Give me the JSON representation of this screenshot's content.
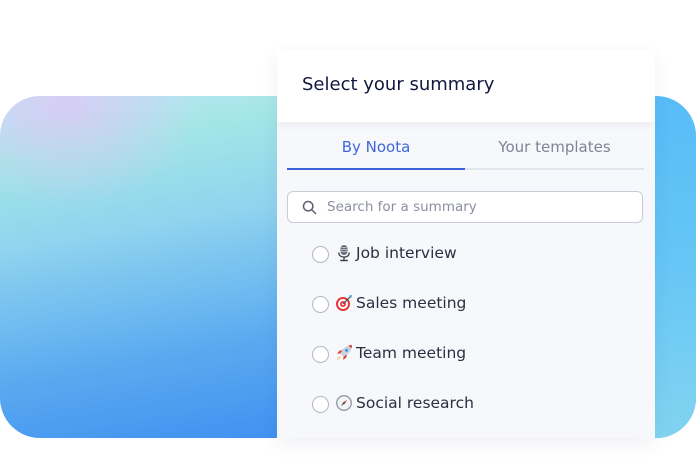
{
  "panel": {
    "title": "Select your summary"
  },
  "tabs": [
    {
      "label": "By Noota",
      "active": true
    },
    {
      "label": "Your templates",
      "active": false
    }
  ],
  "search": {
    "placeholder": "Search for a summary",
    "value": "",
    "icon": "search-icon"
  },
  "options": [
    {
      "label": "Job interview",
      "icon": "microphone-icon",
      "selected": false
    },
    {
      "label": "Sales meeting",
      "icon": "target-icon",
      "selected": false
    },
    {
      "label": "Team meeting",
      "icon": "rocket-icon",
      "selected": false
    },
    {
      "label": "Social research",
      "icon": "compass-icon",
      "selected": false
    }
  ],
  "colors": {
    "accent": "#3c64d8",
    "title": "#11183f",
    "inactive_tab": "#7f8496",
    "panel_background": "#f7f8fc"
  }
}
